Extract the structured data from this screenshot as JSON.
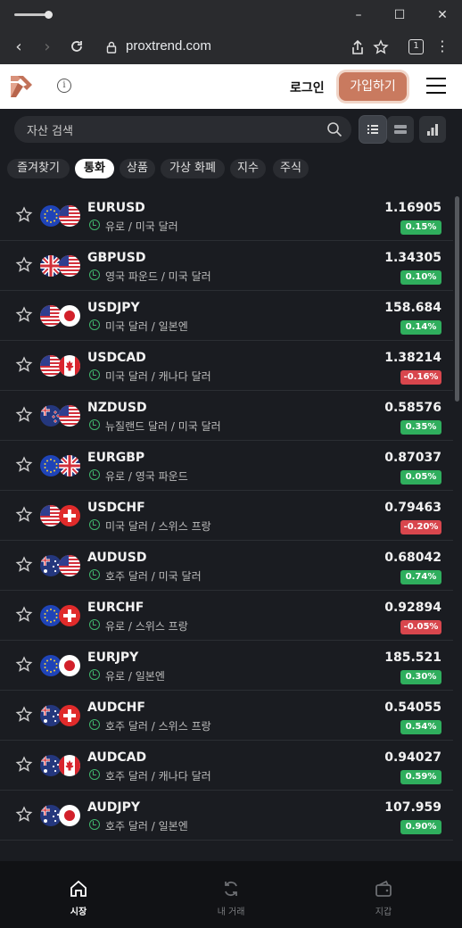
{
  "browser": {
    "url": "proxtrend.com",
    "tab_count": "1"
  },
  "header": {
    "login_label": "로그인",
    "signup_label": "가입하기",
    "brand_color": "#c97a5f"
  },
  "search": {
    "placeholder": "자산 검색"
  },
  "tabs": [
    {
      "label": "즐겨찾기",
      "active": false
    },
    {
      "label": "통화",
      "active": true
    },
    {
      "label": "상품",
      "active": false
    },
    {
      "label": "가상 화폐",
      "active": false
    },
    {
      "label": "지수",
      "active": false
    },
    {
      "label": "주식",
      "active": false
    }
  ],
  "rows": [
    {
      "symbol": "EURUSD",
      "desc": "유로 / 미국 달러",
      "price": "1.16905",
      "change": "0.15%",
      "dir": "up",
      "f1": "eu",
      "f2": "us"
    },
    {
      "symbol": "GBPUSD",
      "desc": "영국 파운드 / 미국 달러",
      "price": "1.34305",
      "change": "0.10%",
      "dir": "up",
      "f1": "gb",
      "f2": "us"
    },
    {
      "symbol": "USDJPY",
      "desc": "미국 달러 / 일본엔",
      "price": "158.684",
      "change": "0.14%",
      "dir": "up",
      "f1": "us",
      "f2": "jp"
    },
    {
      "symbol": "USDCAD",
      "desc": "미국 달러 / 캐나다 달러",
      "price": "1.38214",
      "change": "-0.16%",
      "dir": "down",
      "f1": "us",
      "f2": "ca"
    },
    {
      "symbol": "NZDUSD",
      "desc": "뉴질랜드 달러 / 미국 달러",
      "price": "0.58576",
      "change": "0.35%",
      "dir": "up",
      "f1": "nz",
      "f2": "us"
    },
    {
      "symbol": "EURGBP",
      "desc": "유로 / 영국 파운드",
      "price": "0.87037",
      "change": "0.05%",
      "dir": "up",
      "f1": "eu",
      "f2": "gb"
    },
    {
      "symbol": "USDCHF",
      "desc": "미국 달러 / 스위스 프랑",
      "price": "0.79463",
      "change": "-0.20%",
      "dir": "down",
      "f1": "us",
      "f2": "ch"
    },
    {
      "symbol": "AUDUSD",
      "desc": "호주 달러 / 미국 달러",
      "price": "0.68042",
      "change": "0.74%",
      "dir": "up",
      "f1": "au",
      "f2": "us"
    },
    {
      "symbol": "EURCHF",
      "desc": "유로 / 스위스 프랑",
      "price": "0.92894",
      "change": "-0.05%",
      "dir": "down",
      "f1": "eu",
      "f2": "ch"
    },
    {
      "symbol": "EURJPY",
      "desc": "유로 / 일본엔",
      "price": "185.521",
      "change": "0.30%",
      "dir": "up",
      "f1": "eu",
      "f2": "jp"
    },
    {
      "symbol": "AUDCHF",
      "desc": "호주 달러 / 스위스 프랑",
      "price": "0.54055",
      "change": "0.54%",
      "dir": "up",
      "f1": "au",
      "f2": "ch"
    },
    {
      "symbol": "AUDCAD",
      "desc": "호주 달러 / 캐나다 달러",
      "price": "0.94027",
      "change": "0.59%",
      "dir": "up",
      "f1": "au",
      "f2": "ca"
    },
    {
      "symbol": "AUDJPY",
      "desc": "호주 달러 / 일본엔",
      "price": "107.959",
      "change": "0.90%",
      "dir": "up",
      "f1": "au",
      "f2": "jp"
    }
  ],
  "bottom_nav": [
    {
      "label": "시장",
      "icon": "home-icon",
      "active": true
    },
    {
      "label": "내 거래",
      "icon": "refresh-icon",
      "active": false
    },
    {
      "label": "지갑",
      "icon": "wallet-icon",
      "active": false
    }
  ],
  "colors": {
    "up": "#2fae5d",
    "down": "#d8464d",
    "background": "#1a1c21"
  }
}
